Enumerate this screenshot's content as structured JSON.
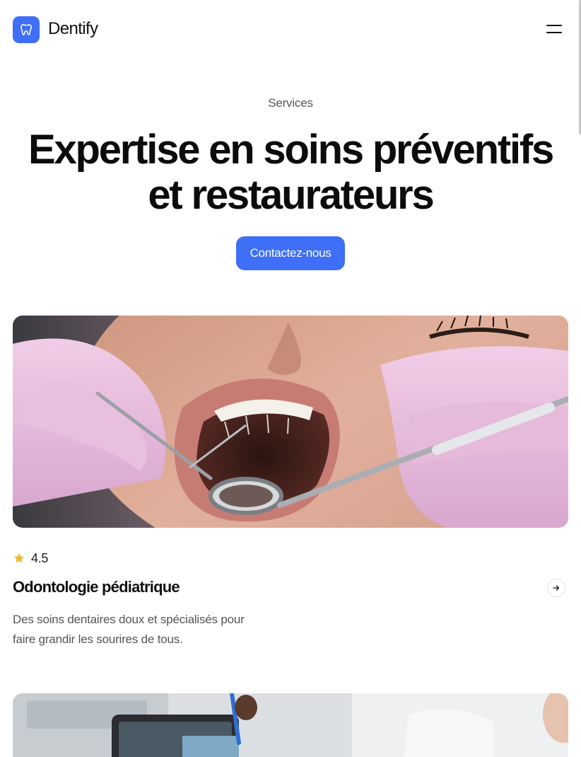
{
  "brand": {
    "name": "Dentify",
    "logo_icon": "tooth-icon",
    "accent": "#3f6ef7"
  },
  "nav": {
    "menu_icon": "hamburger-menu-icon"
  },
  "hero": {
    "eyebrow": "Services",
    "title": "Expertise en soins préventifs et restaurateurs",
    "cta_label": "Contactez-nous"
  },
  "services": [
    {
      "image": "dental-exam-photo",
      "rating": "4.5",
      "title": "Odontologie pédiatrique",
      "description": "Des soins dentaires doux et spécialisés pour faire grandir les sourires de tous.",
      "arrow_icon": "arrow-right-icon"
    },
    {
      "image": "dental-xray-tablet-photo"
    }
  ],
  "colors": {
    "star": "#f5b82e",
    "text": "#111111",
    "muted": "#555555"
  }
}
